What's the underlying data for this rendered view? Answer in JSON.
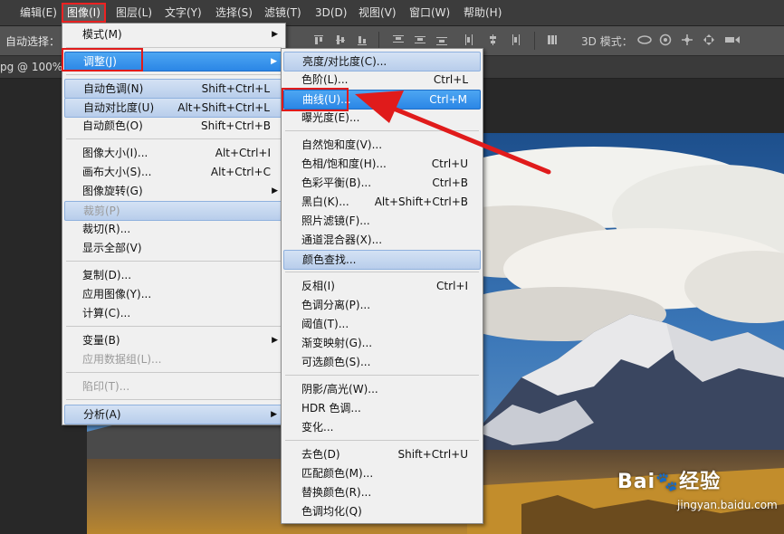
{
  "menubar": {
    "items": [
      {
        "label": "编辑(E)"
      },
      {
        "label": "图像(I)"
      },
      {
        "label": "图层(L)"
      },
      {
        "label": "文字(Y)"
      },
      {
        "label": "选择(S)"
      },
      {
        "label": "滤镜(T)"
      },
      {
        "label": "3D(D)"
      },
      {
        "label": "视图(V)"
      },
      {
        "label": "窗口(W)"
      },
      {
        "label": "帮助(H)"
      }
    ]
  },
  "options_bar": {
    "auto_select_label": "自动选择：",
    "mode_3d_label": "3D 模式："
  },
  "document_tab": {
    "label": "pg @ 100%"
  },
  "image_menu": {
    "items": [
      {
        "label": "模式(M)",
        "shortcut": "",
        "submenu": true
      },
      {
        "label": "调整(J)",
        "shortcut": "",
        "submenu": true
      },
      {
        "label": "自动色调(N)",
        "shortcut": "Shift+Ctrl+L"
      },
      {
        "label": "自动对比度(U)",
        "shortcut": "Alt+Shift+Ctrl+L"
      },
      {
        "label": "自动颜色(O)",
        "shortcut": "Shift+Ctrl+B"
      },
      {
        "label": "图像大小(I)...",
        "shortcut": "Alt+Ctrl+I"
      },
      {
        "label": "画布大小(S)...",
        "shortcut": "Alt+Ctrl+C"
      },
      {
        "label": "图像旋转(G)",
        "shortcut": "",
        "submenu": true
      },
      {
        "label": "裁剪(P)",
        "shortcut": "",
        "disabled": true
      },
      {
        "label": "裁切(R)...",
        "shortcut": ""
      },
      {
        "label": "显示全部(V)",
        "shortcut": ""
      },
      {
        "label": "复制(D)...",
        "shortcut": ""
      },
      {
        "label": "应用图像(Y)...",
        "shortcut": ""
      },
      {
        "label": "计算(C)...",
        "shortcut": ""
      },
      {
        "label": "变量(B)",
        "shortcut": "",
        "submenu": true
      },
      {
        "label": "应用数据组(L)...",
        "shortcut": "",
        "disabled": true
      },
      {
        "label": "陷印(T)...",
        "shortcut": "",
        "disabled": true
      },
      {
        "label": "分析(A)",
        "shortcut": "",
        "submenu": true
      }
    ]
  },
  "adjust_menu": {
    "items": [
      {
        "label": "亮度/对比度(C)...",
        "shortcut": ""
      },
      {
        "label": "色阶(L)...",
        "shortcut": "Ctrl+L"
      },
      {
        "label": "曲线(U)...",
        "shortcut": "Ctrl+M"
      },
      {
        "label": "曝光度(E)...",
        "shortcut": ""
      },
      {
        "label": "自然饱和度(V)...",
        "shortcut": ""
      },
      {
        "label": "色相/饱和度(H)...",
        "shortcut": "Ctrl+U"
      },
      {
        "label": "色彩平衡(B)...",
        "shortcut": "Ctrl+B"
      },
      {
        "label": "黑白(K)...",
        "shortcut": "Alt+Shift+Ctrl+B"
      },
      {
        "label": "照片滤镜(F)...",
        "shortcut": ""
      },
      {
        "label": "通道混合器(X)...",
        "shortcut": ""
      },
      {
        "label": "颜色查找...",
        "shortcut": ""
      },
      {
        "label": "反相(I)",
        "shortcut": "Ctrl+I"
      },
      {
        "label": "色调分离(P)...",
        "shortcut": ""
      },
      {
        "label": "阈值(T)...",
        "shortcut": ""
      },
      {
        "label": "渐变映射(G)...",
        "shortcut": ""
      },
      {
        "label": "可选颜色(S)...",
        "shortcut": ""
      },
      {
        "label": "阴影/高光(W)...",
        "shortcut": ""
      },
      {
        "label": "HDR 色调...",
        "shortcut": ""
      },
      {
        "label": "变化...",
        "shortcut": ""
      },
      {
        "label": "去色(D)",
        "shortcut": "Shift+Ctrl+U"
      },
      {
        "label": "匹配颜色(M)...",
        "shortcut": ""
      },
      {
        "label": "替换颜色(R)...",
        "shortcut": ""
      },
      {
        "label": "色调均化(Q)",
        "shortcut": ""
      }
    ]
  },
  "watermark": {
    "brand": "Bai",
    "brand2": "经验",
    "url": "jingyan.baidu.com"
  },
  "colors": {
    "annotation_red": "#e01b1b",
    "menu_selected": "#2b86e6",
    "menu_highlight": "#b8cdeb"
  }
}
